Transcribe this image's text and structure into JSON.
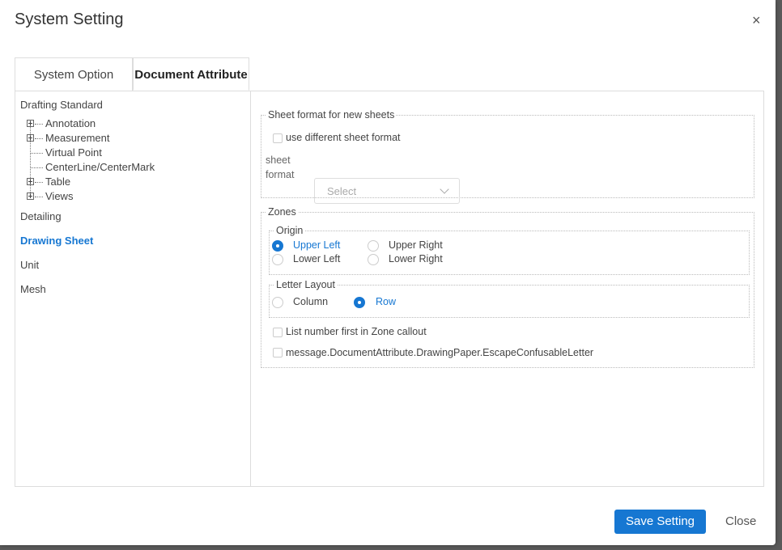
{
  "dialog": {
    "title": "System Setting",
    "close_glyph": "×"
  },
  "tabs": [
    {
      "label": "System Option",
      "active": false
    },
    {
      "label": "Document Attribute",
      "active": true
    }
  ],
  "sidebar": {
    "drafting_standard": "Drafting Standard",
    "tree": [
      {
        "label": "Annotation",
        "expandable": true
      },
      {
        "label": "Measurement",
        "expandable": true
      },
      {
        "label": "Virtual Point",
        "expandable": false
      },
      {
        "label": "CenterLine/CenterMark",
        "expandable": false
      },
      {
        "label": "Table",
        "expandable": true
      },
      {
        "label": "Views",
        "expandable": true
      }
    ],
    "detailing": "Detailing",
    "drawing_sheet": "Drawing Sheet",
    "unit": "Unit",
    "mesh": "Mesh",
    "selected": "Drawing Sheet"
  },
  "sheet_format": {
    "legend": "Sheet format for new sheets",
    "use_different_label": "use different sheet format",
    "use_different_checked": false,
    "field_label_line1": "sheet",
    "field_label_line2": "format",
    "placeholder": "Select"
  },
  "zones": {
    "legend": "Zones",
    "origin": {
      "legend": "Origin",
      "options": [
        "Upper Left",
        "Upper Right",
        "Lower Left",
        "Lower Right"
      ],
      "selected": "Upper Left"
    },
    "letter_layout": {
      "legend": "Letter Layout",
      "options": [
        "Column",
        "Row"
      ],
      "selected": "Row"
    },
    "list_number_label": "List number first in Zone callout",
    "list_number_checked": false,
    "escape_label": "message.DocumentAttribute.DrawingPaper.EscapeConfusableLetter",
    "escape_checked": false
  },
  "footer": {
    "save_label": "Save Setting",
    "close_label": "Close"
  },
  "colors": {
    "accent": "#1677d2"
  }
}
